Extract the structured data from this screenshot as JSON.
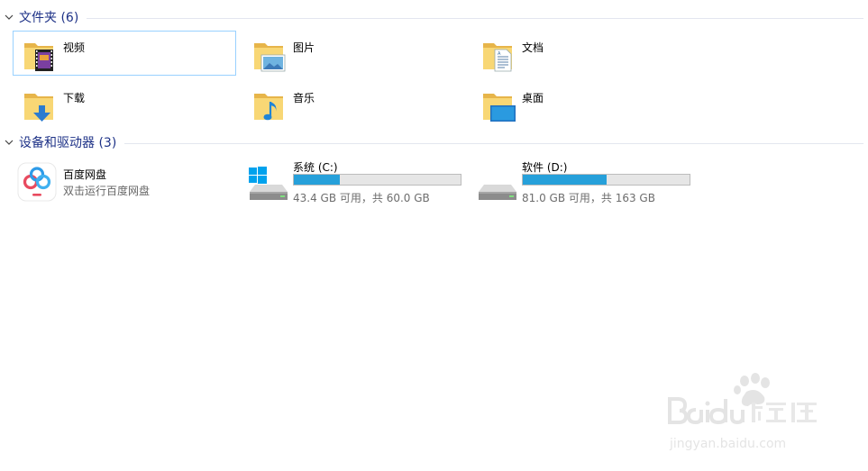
{
  "groups": {
    "folders": {
      "title": "文件夹 (6)",
      "items": [
        {
          "label": "视频",
          "icon": "videos-folder-icon"
        },
        {
          "label": "图片",
          "icon": "pictures-folder-icon"
        },
        {
          "label": "文档",
          "icon": "documents-folder-icon"
        },
        {
          "label": "下载",
          "icon": "downloads-folder-icon"
        },
        {
          "label": "音乐",
          "icon": "music-folder-icon"
        },
        {
          "label": "桌面",
          "icon": "desktop-folder-icon"
        }
      ]
    },
    "devices": {
      "title": "设备和驱动器 (3)",
      "baidu": {
        "label": "百度网盘",
        "sublabel": "双击运行百度网盘",
        "icon": "baidu-netdisk-icon"
      },
      "drives": [
        {
          "label": "系统 (C:)",
          "space": "43.4 GB 可用，共 60.0 GB",
          "used_fraction": 0.277,
          "icon": "windows-drive-icon"
        },
        {
          "label": "软件 (D:)",
          "space": "81.0 GB 可用，共 163 GB",
          "used_fraction": 0.503,
          "icon": "hard-drive-icon"
        }
      ]
    }
  },
  "colors": {
    "header_text": "#1e3287",
    "usage_bar": "#26a0da",
    "selection_border": "#99d1ff",
    "folder_yellow": "#f8d775"
  }
}
